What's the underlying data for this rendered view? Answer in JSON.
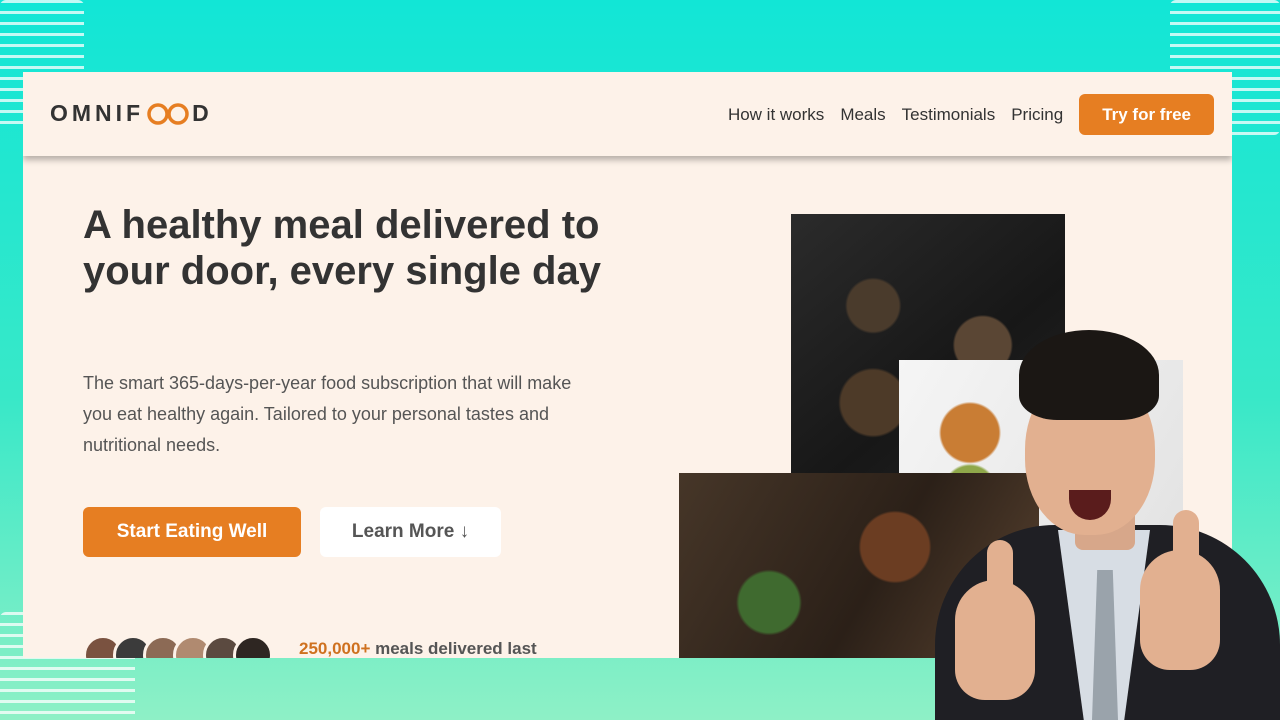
{
  "brand": {
    "name_left": "OMNIF",
    "name_right": "D",
    "accent": "#e67e22"
  },
  "nav": {
    "links": [
      "How it works",
      "Meals",
      "Testimonials",
      "Pricing"
    ],
    "cta": "Try for free"
  },
  "hero": {
    "title": "A healthy meal delivered to your door, every single day",
    "description": "The smart 365-days-per-year food subscription that will make you eat healthy again. Tailored to your personal tastes and nutritional needs.",
    "primary_button": "Start Eating Well",
    "secondary_button": "Learn More ↓",
    "delivered_highlight": "250,000+",
    "delivered_text": " meals delivered last"
  },
  "avatar_colors": [
    "#7a5240",
    "#3b3b3b",
    "#8c6a55",
    "#b08a70",
    "#5b4a40",
    "#2e2622"
  ],
  "icons": [
    "logo-infinity-icon"
  ]
}
